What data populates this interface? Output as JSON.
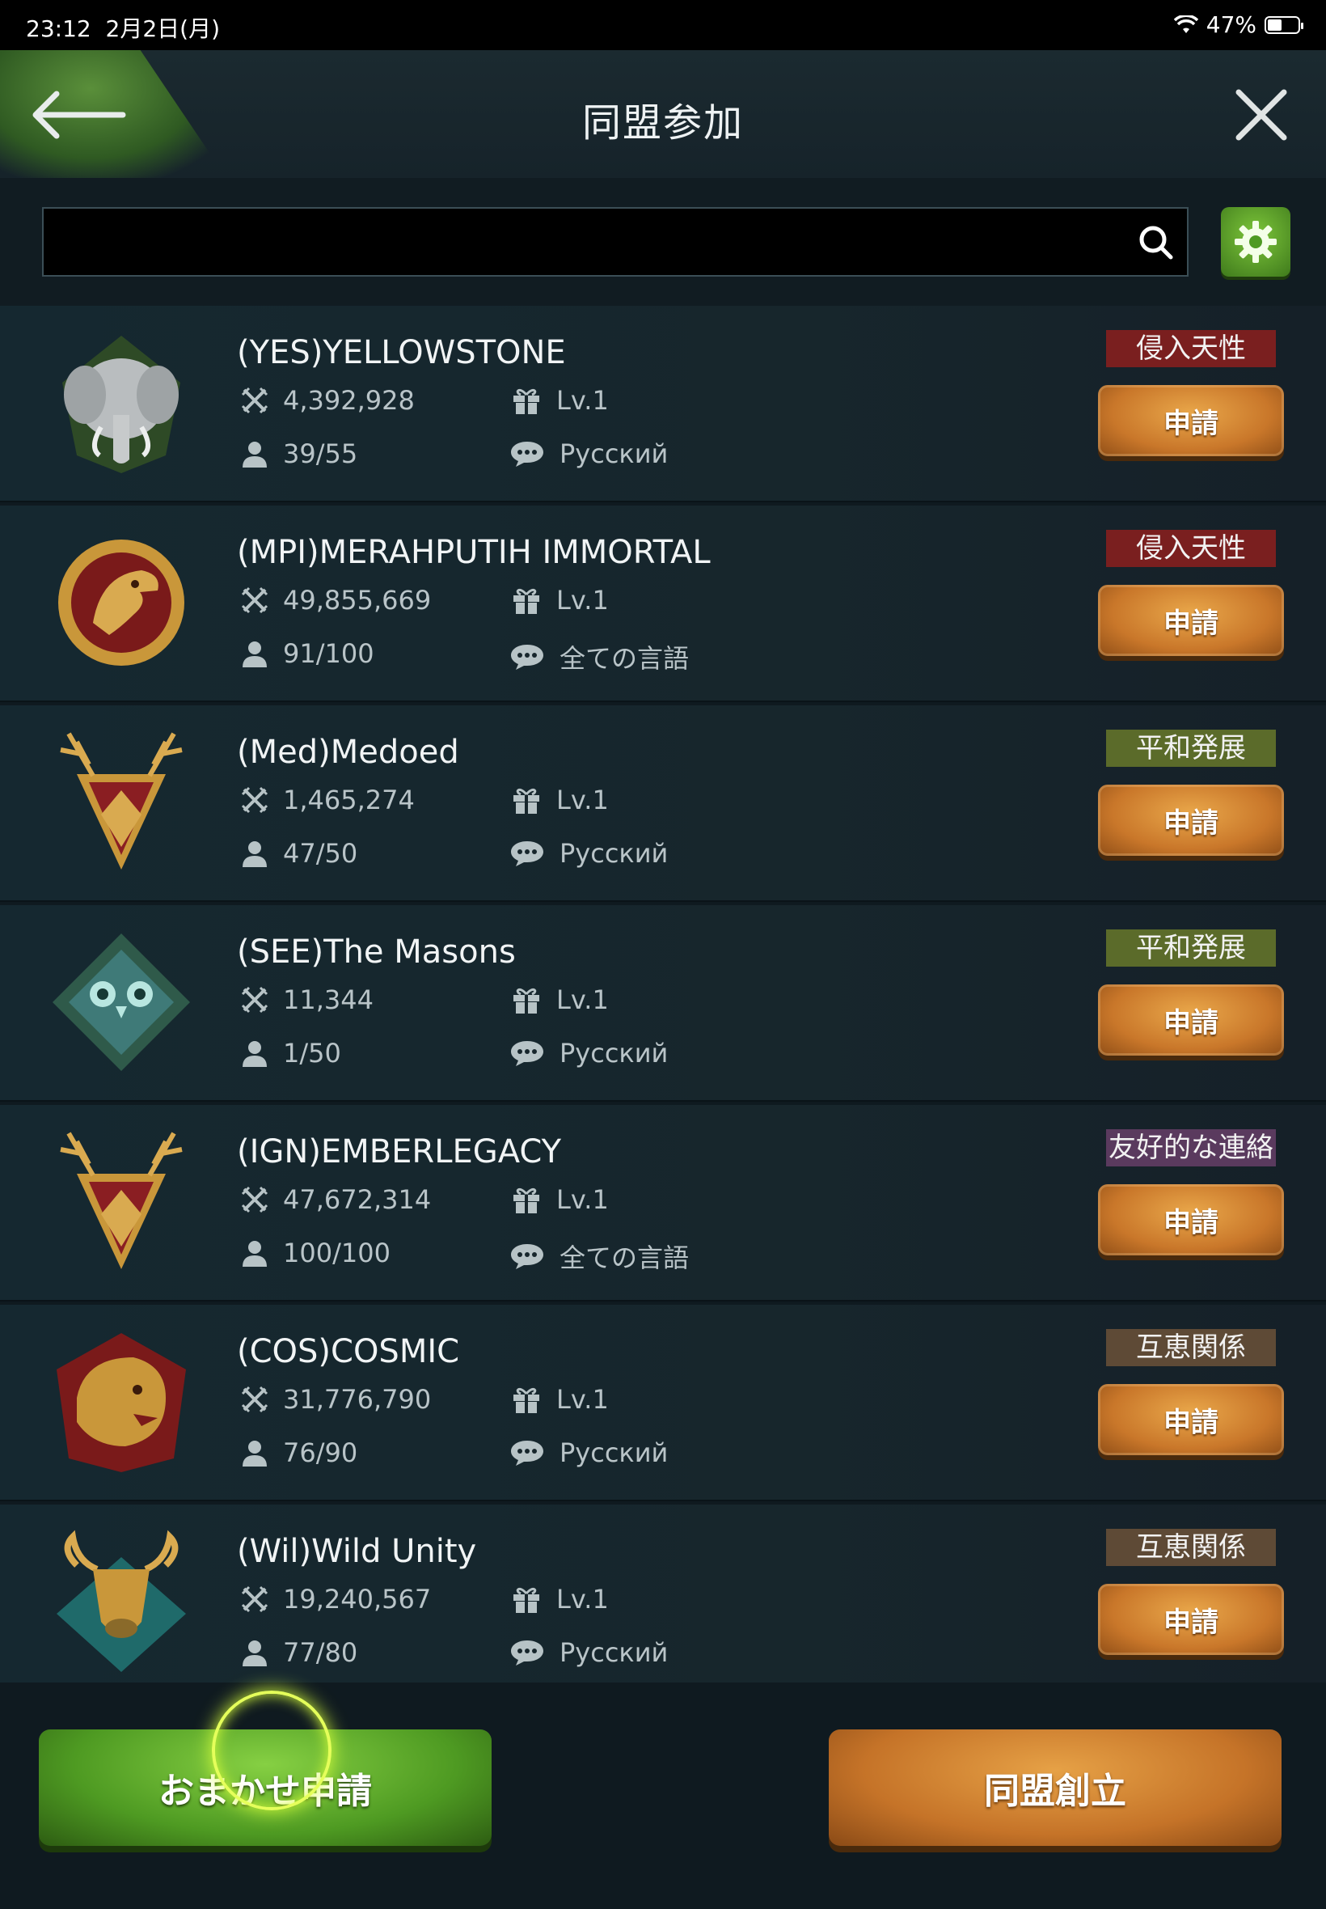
{
  "status_bar": {
    "time": "23:12",
    "date": "2月2日(月)",
    "battery_text": "47%",
    "battery_level": 0.47
  },
  "header": {
    "title": "同盟参加"
  },
  "search": {
    "value": "",
    "placeholder": ""
  },
  "alliances": [
    {
      "name": "(YES)YELLOWSTONE",
      "power": "4,392,928",
      "level": "Lv.1",
      "members": "39/55",
      "language": "Русский",
      "tag": "侵入天性",
      "tag_color": "#7a1f1f",
      "apply_label": "申請",
      "emblem": "elephant-emblem"
    },
    {
      "name": "(MPI)MERAHPUTIH IMMORTAL",
      "power": "49,855,669",
      "level": "Lv.1",
      "members": "91/100",
      "language": "全ての言語",
      "tag": "侵入天性",
      "tag_color": "#7a1f1f",
      "apply_label": "申請",
      "emblem": "eagle-emblem"
    },
    {
      "name": "(Med)Medoed",
      "power": "1,465,274",
      "level": "Lv.1",
      "members": "47/50",
      "language": "Русский",
      "tag": "平和発展",
      "tag_color": "#5b6b2a",
      "apply_label": "申請",
      "emblem": "stag-emblem"
    },
    {
      "name": "(SEE)The Masons",
      "power": "11,344",
      "level": "Lv.1",
      "members": "1/50",
      "language": "Русский",
      "tag": "平和発展",
      "tag_color": "#5b6b2a",
      "apply_label": "申請",
      "emblem": "owl-emblem"
    },
    {
      "name": "(IGN)EMBERLEGACY",
      "power": "47,672,314",
      "level": "Lv.1",
      "members": "100/100",
      "language": "全ての言語",
      "tag": "友好的な連絡",
      "tag_color": "#5a3a5e",
      "apply_label": "申請",
      "emblem": "stag-emblem"
    },
    {
      "name": "(COS)COSMIC",
      "power": "31,776,790",
      "level": "Lv.1",
      "members": "76/90",
      "language": "Русский",
      "tag": "互恵関係",
      "tag_color": "#5e4a36",
      "apply_label": "申請",
      "emblem": "tiger-emblem"
    },
    {
      "name": "(Wil)Wild Unity",
      "power": "19,240,567",
      "level": "Lv.1",
      "members": "77/80",
      "language": "Русский",
      "tag": "互恵関係",
      "tag_color": "#5e4a36",
      "apply_label": "申請",
      "emblem": "bull-emblem"
    }
  ],
  "footer": {
    "auto_apply_label": "おまかせ申請",
    "create_label": "同盟創立"
  }
}
